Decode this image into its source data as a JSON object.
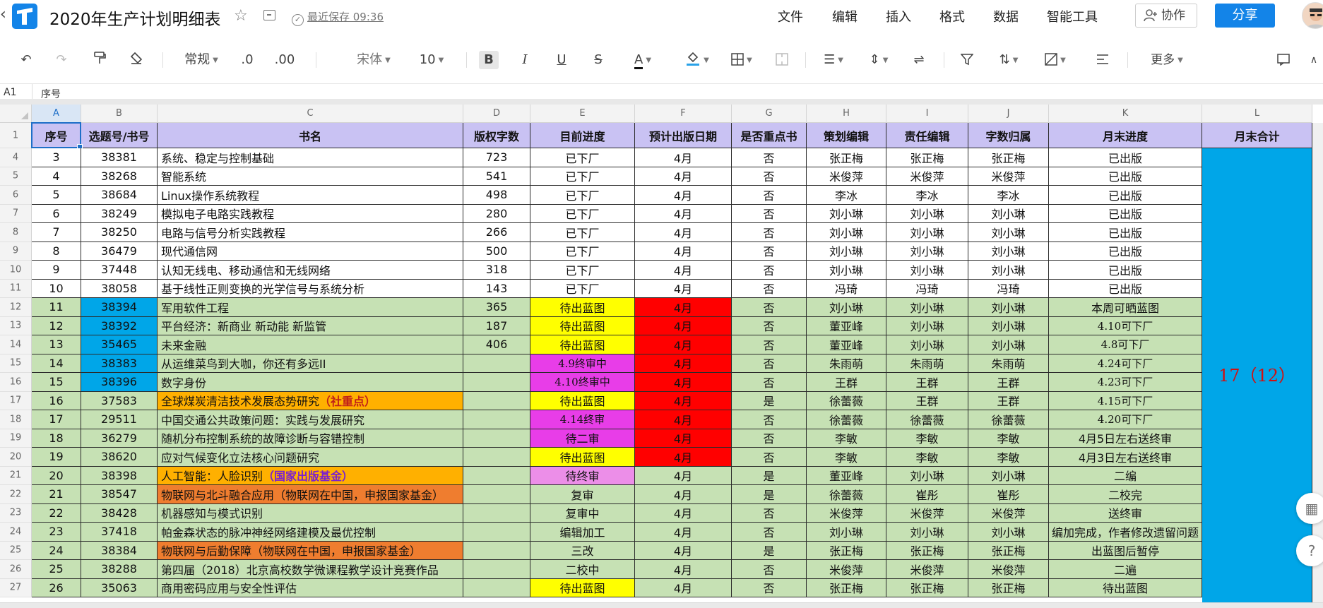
{
  "titlebar": {
    "title": "2020年生产计划明细表",
    "saved_status": "最近保存 09:36",
    "menus": [
      "文件",
      "编辑",
      "插入",
      "格式",
      "数据",
      "智能工具"
    ],
    "collab_label": "协作",
    "share_label": "分享",
    "brand_color": "#1384e8"
  },
  "toolbar": {
    "number_format": "常规",
    "decimal_decrease": ".0",
    "decimal_increase": ".00",
    "font_name": "宋体",
    "font_size": "10",
    "bold": "B",
    "italic": "I",
    "underline": "U",
    "strike": "S",
    "font_color_letter": "A",
    "more_label": "更多"
  },
  "formula_bar": {
    "cell_ref": "A1",
    "value": "序号"
  },
  "columns": [
    "A",
    "B",
    "C",
    "D",
    "E",
    "F",
    "G",
    "H",
    "I",
    "J",
    "K",
    "L"
  ],
  "header_row": {
    "row_number": "1",
    "cells": [
      "序号",
      "选题号/书号",
      "书名",
      "版权字数",
      "目前进度",
      "预计出版日期",
      "是否重点书",
      "策划编辑",
      "责任编辑",
      "字数归属",
      "月末进度",
      "月末合计"
    ]
  },
  "colors": {
    "header_purple": "#c9c2f3",
    "row_green": "#c6e1b4",
    "blue": "#00a6e8",
    "yellow": "#ffff00",
    "red": "#ff0000",
    "magenta": "#e83de8",
    "orange": "#ffb000",
    "orange_dark": "#ef7d2f",
    "violet": "#ec8ee8",
    "merged_text": "#d30f0f"
  },
  "merged_total": "17（12）",
  "rows": [
    {
      "r": "4",
      "seq": "3",
      "id": "38381",
      "name": "系统、稳定与控制基础",
      "words": "723",
      "progress": "已下厂",
      "date": "4月",
      "key": "否",
      "planner": "张正梅",
      "editor": "张正梅",
      "owner": "张正梅",
      "month_end": "已出版",
      "style": "white"
    },
    {
      "r": "5",
      "seq": "4",
      "id": "38268",
      "name": "智能系统",
      "words": "541",
      "progress": "已下厂",
      "date": "4月",
      "key": "否",
      "planner": "米俊萍",
      "editor": "米俊萍",
      "owner": "米俊萍",
      "month_end": "已出版",
      "style": "white"
    },
    {
      "r": "6",
      "seq": "5",
      "id": "38684",
      "name": "Linux操作系统教程",
      "words": "498",
      "progress": "已下厂",
      "date": "4月",
      "key": "否",
      "planner": "李冰",
      "editor": "李冰",
      "owner": "李冰",
      "month_end": "已出版",
      "style": "white"
    },
    {
      "r": "7",
      "seq": "6",
      "id": "38249",
      "name": "模拟电子电路实践教程",
      "words": "280",
      "progress": "已下厂",
      "date": "4月",
      "key": "否",
      "planner": "刘小琳",
      "editor": "刘小琳",
      "owner": "刘小琳",
      "month_end": "已出版",
      "style": "white"
    },
    {
      "r": "8",
      "seq": "7",
      "id": "38250",
      "name": "电路与信号分析实践教程",
      "words": "266",
      "progress": "已下厂",
      "date": "4月",
      "key": "否",
      "planner": "刘小琳",
      "editor": "刘小琳",
      "owner": "刘小琳",
      "month_end": "已出版",
      "style": "white"
    },
    {
      "r": "9",
      "seq": "8",
      "id": "36479",
      "name": "现代通信网",
      "words": "500",
      "progress": "已下厂",
      "date": "4月",
      "key": "否",
      "planner": "刘小琳",
      "editor": "刘小琳",
      "owner": "刘小琳",
      "month_end": "已出版",
      "style": "white"
    },
    {
      "r": "10",
      "seq": "9",
      "id": "37448",
      "name": "认知无线电、移动通信和无线网络",
      "words": "318",
      "progress": "已下厂",
      "date": "4月",
      "key": "否",
      "planner": "刘小琳",
      "editor": "刘小琳",
      "owner": "刘小琳",
      "month_end": "已出版",
      "style": "white"
    },
    {
      "r": "11",
      "seq": "10",
      "id": "38058",
      "name": "基于线性正则变换的光学信号与系统分析",
      "words": "143",
      "progress": "已下厂",
      "date": "4月",
      "key": "否",
      "planner": "冯琦",
      "editor": "冯琦",
      "owner": "冯琦",
      "month_end": "已出版",
      "style": "white"
    },
    {
      "r": "12",
      "seq": "11",
      "id": "38394",
      "name": "军用软件工程",
      "words": "365",
      "progress": "待出蓝图",
      "date": "4月",
      "key": "否",
      "planner": "刘小琳",
      "editor": "刘小琳",
      "owner": "刘小琳",
      "month_end": "本周可晒蓝图",
      "style": "green",
      "idc": "blue",
      "pc": "yellow",
      "dc": "red"
    },
    {
      "r": "13",
      "seq": "12",
      "id": "38392",
      "name": "平台经济：新商业 新动能 新监管",
      "words": "187",
      "progress": "待出蓝图",
      "date": "4月",
      "key": "否",
      "planner": "董亚峰",
      "editor": "刘小琳",
      "owner": "刘小琳",
      "month_end": "4.10可下厂",
      "style": "green",
      "idc": "blue",
      "pc": "yellow",
      "dc": "red",
      "meserif": true
    },
    {
      "r": "14",
      "seq": "13",
      "id": "35465",
      "name": "未来金融",
      "words": "406",
      "progress": "待出蓝图",
      "date": "4月",
      "key": "否",
      "planner": "董亚峰",
      "editor": "刘小琳",
      "owner": "刘小琳",
      "month_end": "4.8可下厂",
      "style": "green",
      "idc": "blue",
      "pc": "yellow",
      "dc": "red",
      "meserif": true
    },
    {
      "r": "15",
      "seq": "14",
      "id": "38383",
      "name": "从运维菜鸟到大咖，你还有多远II",
      "words": "",
      "progress": "4.9终审中",
      "date": "4月",
      "key": "否",
      "planner": "朱雨萌",
      "editor": "朱雨萌",
      "owner": "朱雨萌",
      "month_end": "4.24可下厂",
      "style": "green",
      "idc": "blue",
      "pc": "magenta",
      "dc": "red",
      "pserif": true,
      "meserif": true
    },
    {
      "r": "16",
      "seq": "15",
      "id": "38396",
      "name": "数字身份",
      "words": "",
      "progress": "4.10终审中",
      "date": "4月",
      "key": "否",
      "planner": "王群",
      "editor": "王群",
      "owner": "王群",
      "month_end": "4.23可下厂",
      "style": "green",
      "idc": "blue",
      "pc": "magenta",
      "dc": "red",
      "pserif": true,
      "meserif": true
    },
    {
      "r": "17",
      "seq": "16",
      "id": "37583",
      "name": "全球煤炭清洁技术发展态势研究",
      "name_hl": "（社重点）",
      "hlcolor": "hlr",
      "words": "",
      "progress": "待出蓝图",
      "date": "4月",
      "key": "是",
      "planner": "徐蕾薇",
      "editor": "王群",
      "owner": "王群",
      "month_end": "4.15可下厂",
      "style": "green",
      "nc": "orange",
      "pc": "yellow",
      "dc": "red",
      "meserif": true
    },
    {
      "r": "18",
      "seq": "17",
      "id": "29511",
      "name": "中国交通公共政策问题：实践与发展研究",
      "words": "",
      "progress": "4.14终审",
      "date": "4月",
      "key": "否",
      "planner": "徐蕾薇",
      "editor": "徐蕾薇",
      "owner": "徐蕾薇",
      "month_end": "4.20可下厂",
      "style": "green",
      "pc": "magenta",
      "dc": "red",
      "pserif": true,
      "meserif": true
    },
    {
      "r": "19",
      "seq": "18",
      "id": "36279",
      "name": "随机分布控制系统的故障诊断与容错控制",
      "words": "",
      "progress": "待二审",
      "date": "4月",
      "key": "否",
      "planner": "李敏",
      "editor": "李敏",
      "owner": "李敏",
      "month_end": "4月5日左右送终审",
      "style": "green",
      "pc": "magenta",
      "dc": "red"
    },
    {
      "r": "20",
      "seq": "19",
      "id": "38620",
      "name": "应对气候变化立法核心问题研究",
      "words": "",
      "progress": "待出蓝图",
      "date": "4月",
      "key": "否",
      "planner": "李敏",
      "editor": "李敏",
      "owner": "李敏",
      "month_end": "4月3日左右送终审",
      "style": "green",
      "pc": "yellow",
      "dc": "red"
    },
    {
      "r": "21",
      "seq": "20",
      "id": "38398",
      "name": "人工智能：人脸识别",
      "name_hl": "（国家出版基金）",
      "hlcolor": "hl",
      "words": "",
      "progress": "待终审",
      "date": "4月",
      "key": "是",
      "planner": "董亚峰",
      "editor": "刘小琳",
      "owner": "刘小琳",
      "month_end": "二编",
      "style": "green",
      "nc": "orange",
      "pc": "violet"
    },
    {
      "r": "22",
      "seq": "21",
      "id": "38547",
      "name": "物联网与北斗融合应用（物联网在中国，申报国家基金）",
      "words": "",
      "progress": "复审",
      "date": "4月",
      "key": "是",
      "planner": "徐蕾薇",
      "editor": "崔彤",
      "owner": "崔彤",
      "month_end": "二校完",
      "style": "green",
      "nc": "orange_dark"
    },
    {
      "r": "23",
      "seq": "22",
      "id": "38428",
      "name": "机器感知与模式识别",
      "words": "",
      "progress": "复审中",
      "date": "4月",
      "key": "否",
      "planner": "米俊萍",
      "editor": "米俊萍",
      "owner": "米俊萍",
      "month_end": "送终审",
      "style": "green"
    },
    {
      "r": "24",
      "seq": "23",
      "id": "37418",
      "name": "帕金森状态的脉冲神经网络建模及最优控制",
      "words": "",
      "progress": "编辑加工",
      "date": "4月",
      "key": "否",
      "planner": "刘小琳",
      "editor": "刘小琳",
      "owner": "刘小琳",
      "month_end": "编加完成，作者修改遗留问题",
      "style": "green"
    },
    {
      "r": "25",
      "seq": "24",
      "id": "38384",
      "name": "物联网与后勤保障（物联网在中国，申报国家基金）",
      "words": "",
      "progress": "三改",
      "date": "4月",
      "key": "是",
      "planner": "张正梅",
      "editor": "张正梅",
      "owner": "张正梅",
      "month_end": "出蓝图后暂停",
      "style": "green",
      "nc": "orange_dark"
    },
    {
      "r": "26",
      "seq": "25",
      "id": "38288",
      "name": "第四届（2018）北京高校数学微课程教学设计竞赛作品",
      "words": "",
      "progress": "二校中",
      "date": "4月",
      "key": "否",
      "planner": "米俊萍",
      "editor": "米俊萍",
      "owner": "米俊萍",
      "month_end": "二遍",
      "style": "green"
    },
    {
      "r": "27",
      "seq": "26",
      "id": "35063",
      "name": "商用密码应用与安全性评估",
      "words": "",
      "progress": "待出蓝图",
      "date": "4月",
      "key": "否",
      "planner": "张正梅",
      "editor": "张正梅",
      "owner": "张正梅",
      "month_end": "待出蓝图",
      "style": "green",
      "pc": "yellow"
    }
  ]
}
